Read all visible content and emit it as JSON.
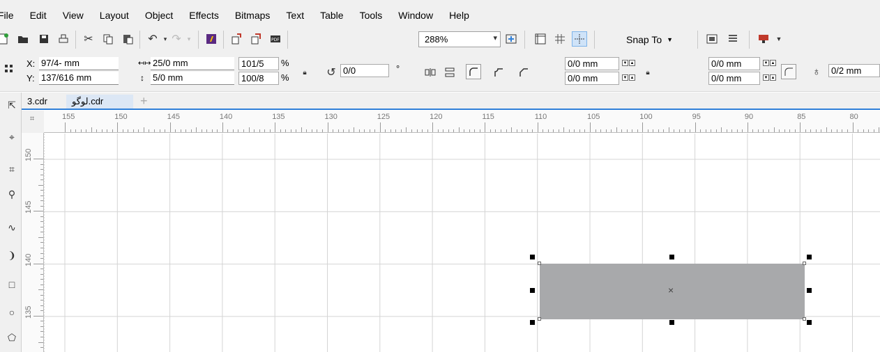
{
  "menu": [
    "File",
    "Edit",
    "View",
    "Layout",
    "Object",
    "Effects",
    "Bitmaps",
    "Text",
    "Table",
    "Tools",
    "Window",
    "Help"
  ],
  "toolbar": {
    "icons": [
      "new-document-icon",
      "open-folder-icon",
      "save-icon",
      "print-icon",
      "cut-icon",
      "copy-icon",
      "paste-icon",
      "undo-icon",
      "redo-icon",
      "corel-connect-icon",
      "import-icon",
      "export-icon",
      "publish-pdf-icon",
      "full-screen-preview-icon",
      "show-rulers-icon",
      "show-grid-icon",
      "show-guidelines-icon",
      "options-icon",
      "application-launcher-icon",
      "welcome-screen-icon"
    ],
    "zoom": "288%",
    "snap_label": "Snap To"
  },
  "propbar": {
    "x_label": "X:",
    "x_value": "97/4- mm",
    "y_label": "Y:",
    "y_value": "137/616 mm",
    "width_value": "25/0 mm",
    "height_value": "5/0 mm",
    "scale_w": "101/5",
    "scale_h": "100/8",
    "percent": "%",
    "rotation": "0/0",
    "degree": "°",
    "corner_top_left": "0/0 mm",
    "corner_bottom_left": "0/0 mm",
    "corner_top_right": "0/0 mm",
    "corner_bottom_right": "0/0 mm",
    "outline_width": "0/2 mm"
  },
  "tabs": [
    {
      "label": "3.cdr"
    },
    {
      "label": "لوگو.cdr"
    }
  ],
  "rulers": {
    "top": [
      "155",
      "150",
      "145",
      "140",
      "135",
      "130",
      "125",
      "120",
      "115",
      "110",
      "105",
      "100",
      "95",
      "90",
      "85",
      "80"
    ],
    "left": [
      "150",
      "145",
      "140",
      "135"
    ]
  },
  "tools": [
    "pick-tool-icon",
    "shape-tool-icon",
    "crop-tool-icon",
    "zoom-tool-icon",
    "freehand-tool-icon",
    "artistic-media-icon",
    "rectangle-tool-icon",
    "ellipse-tool-icon",
    "polygon-tool-icon"
  ],
  "colors": {
    "selected_fill": "#a8a9ab",
    "tab_accent": "#2f7fd8"
  }
}
